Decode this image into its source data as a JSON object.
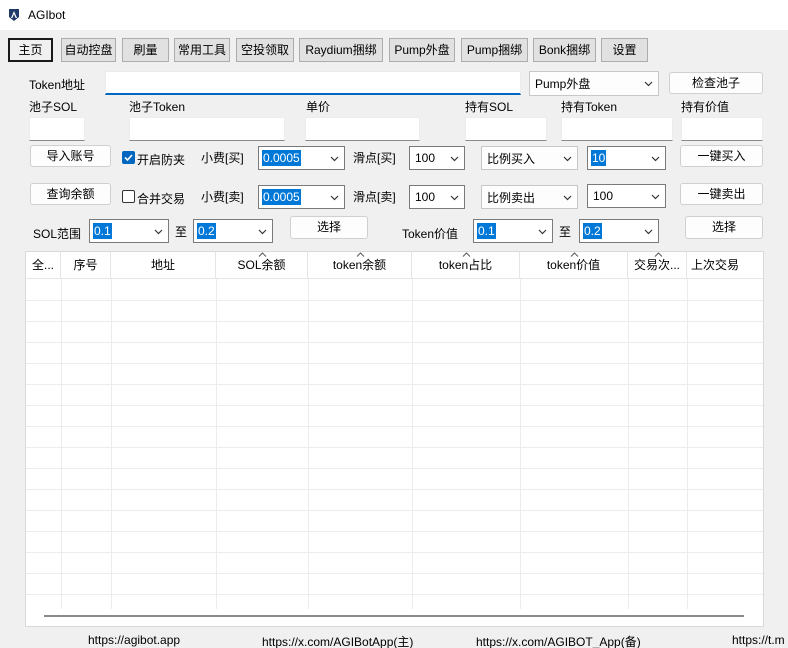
{
  "window": {
    "title": "AGIbot"
  },
  "tabs": [
    {
      "label": "主页",
      "active": true
    },
    {
      "label": "自动控盘"
    },
    {
      "label": "刷量"
    },
    {
      "label": "常用工具"
    },
    {
      "label": "空投领取"
    },
    {
      "label": "Raydium捆绑"
    },
    {
      "label": "Pump外盘"
    },
    {
      "label": "Pump捆绑"
    },
    {
      "label": "Bonk捆绑"
    },
    {
      "label": "设置"
    }
  ],
  "form": {
    "token_address_label": "Token地址",
    "token_address_value": "",
    "pool_type_select": "Pump外盘",
    "check_pool_button": "检查池子",
    "pool_sol_label": "池子SOL",
    "pool_token_label": "池子Token",
    "unit_price_label": "单价",
    "holding_sol_label": "持有SOL",
    "holding_token_label": "持有Token",
    "holding_value_label": "持有价值",
    "import_accounts_button": "导入账号",
    "enable_anti_sandwich_label": "开启防夹",
    "enable_anti_sandwich_checked": true,
    "tip_buy_label": "小费[买]",
    "tip_buy_value": "0.0005",
    "slippage_buy_label": "滑点[买]",
    "slippage_buy_value": "100",
    "buy_mode_select": "比例买入",
    "buy_ratio_value": "10",
    "one_click_buy_button": "一键买入",
    "query_balance_button": "查询余额",
    "merge_trade_label": "合并交易",
    "merge_trade_checked": false,
    "tip_sell_label": "小费[卖]",
    "tip_sell_value": "0.0005",
    "slippage_sell_label": "滑点[卖]",
    "slippage_sell_value": "100",
    "sell_mode_select": "比例卖出",
    "sell_ratio_value": "100",
    "one_click_sell_button": "一键卖出",
    "sol_range_label": "SOL范围",
    "sol_range_min": "0.1",
    "sol_range_to": "至",
    "sol_range_max": "0.2",
    "select_button_1": "选择",
    "token_value_label": "Token价值",
    "token_value_min": "0.1",
    "token_value_to": "至",
    "token_value_max": "0.2",
    "select_button_2": "选择"
  },
  "table": {
    "columns": [
      "全...",
      "序号",
      "地址",
      "SOL余额",
      "token余额",
      "token占比",
      "token价值",
      "交易次...",
      "上次交易"
    ],
    "rows": []
  },
  "statusbar": {
    "links": [
      "https://agibot.app",
      "https://x.com/AGIBotApp(主)",
      "https://x.com/AGIBOT_App(备)",
      "https://t.m"
    ]
  },
  "colors": {
    "accent": "#0067c0",
    "selection": "#0078d7"
  }
}
